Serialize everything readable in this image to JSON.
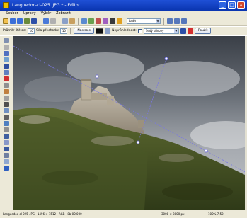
{
  "window": {
    "title": "Languedoc-cl-025 .JPG * - Editor"
  },
  "menu": {
    "items": [
      "Soubor",
      "Úpravy",
      "Výběr",
      "Zobrazit"
    ]
  },
  "toolbar": {
    "zoom_select": "Ladit"
  },
  "brush_options": {
    "width_label": "Průměr štětce:",
    "width_value": "10",
    "transparency_label": "Síla přechodu:",
    "transparency_value": "10",
    "preset_button": "Nástroje",
    "opacity_label": "Neprůhlednost:",
    "checkbox_label": "Šedý stínový",
    "apply_button": "Použít"
  },
  "status": {
    "left": "Languedoc-cl-025 .JPG · 1496 × 1512 · RGB · 8b 00 000",
    "middle": "3008 × 3000 px",
    "right": "100% 7:52"
  },
  "colors": {
    "title_bar": "#0a35b0",
    "chrome": "#ece9d8",
    "guide_line": "#7a78e0",
    "guide_handle": "#5a5ad8"
  }
}
